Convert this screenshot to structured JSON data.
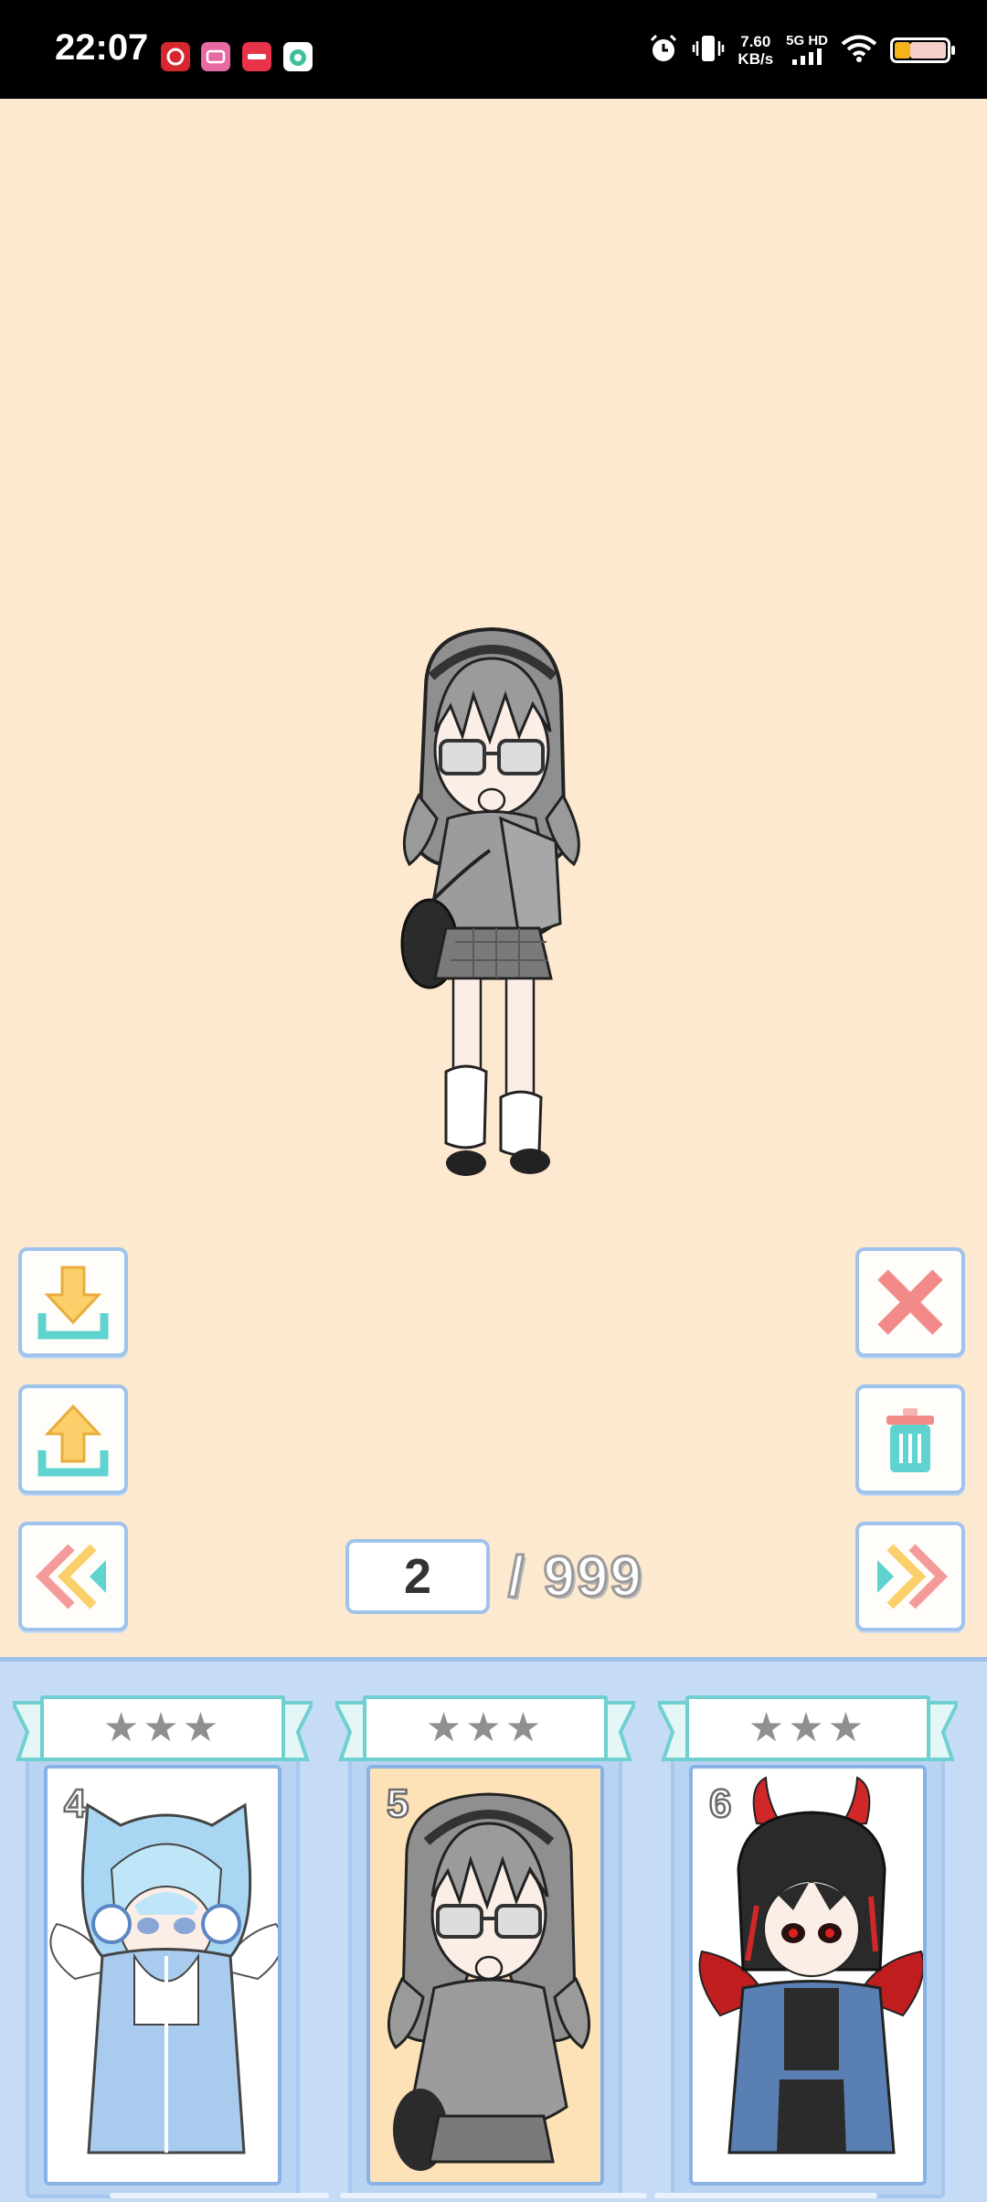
{
  "status_bar": {
    "time": "22:07",
    "net_speed_value": "7.60",
    "net_speed_unit": "KB/s",
    "network_type": "5G HD",
    "battery_level": 0.3,
    "notification_icons": [
      "netease-music-icon",
      "bilibili-icon",
      "xiaohongshu-icon",
      "app-icon"
    ]
  },
  "toolbar": {
    "download_icon": "download-icon",
    "upload_icon": "upload-icon",
    "previous_icon": "double-chevron-left-icon",
    "close_icon": "close-icon",
    "delete_icon": "trash-icon",
    "next_icon": "double-chevron-right-icon"
  },
  "pager": {
    "current": "2",
    "total": "/ 999"
  },
  "slots": [
    {
      "number": "4",
      "stars": "★★★",
      "selected": false
    },
    {
      "number": "5",
      "stars": "★★★",
      "selected": true
    },
    {
      "number": "6",
      "stars": "★★★",
      "selected": false
    }
  ],
  "colors": {
    "background": "#fde9cf",
    "accent_teal": "#5fd3d0",
    "accent_yellow": "#fbd06a",
    "close_red": "#f28a8a",
    "panel_blue": "#c6dcf6"
  }
}
